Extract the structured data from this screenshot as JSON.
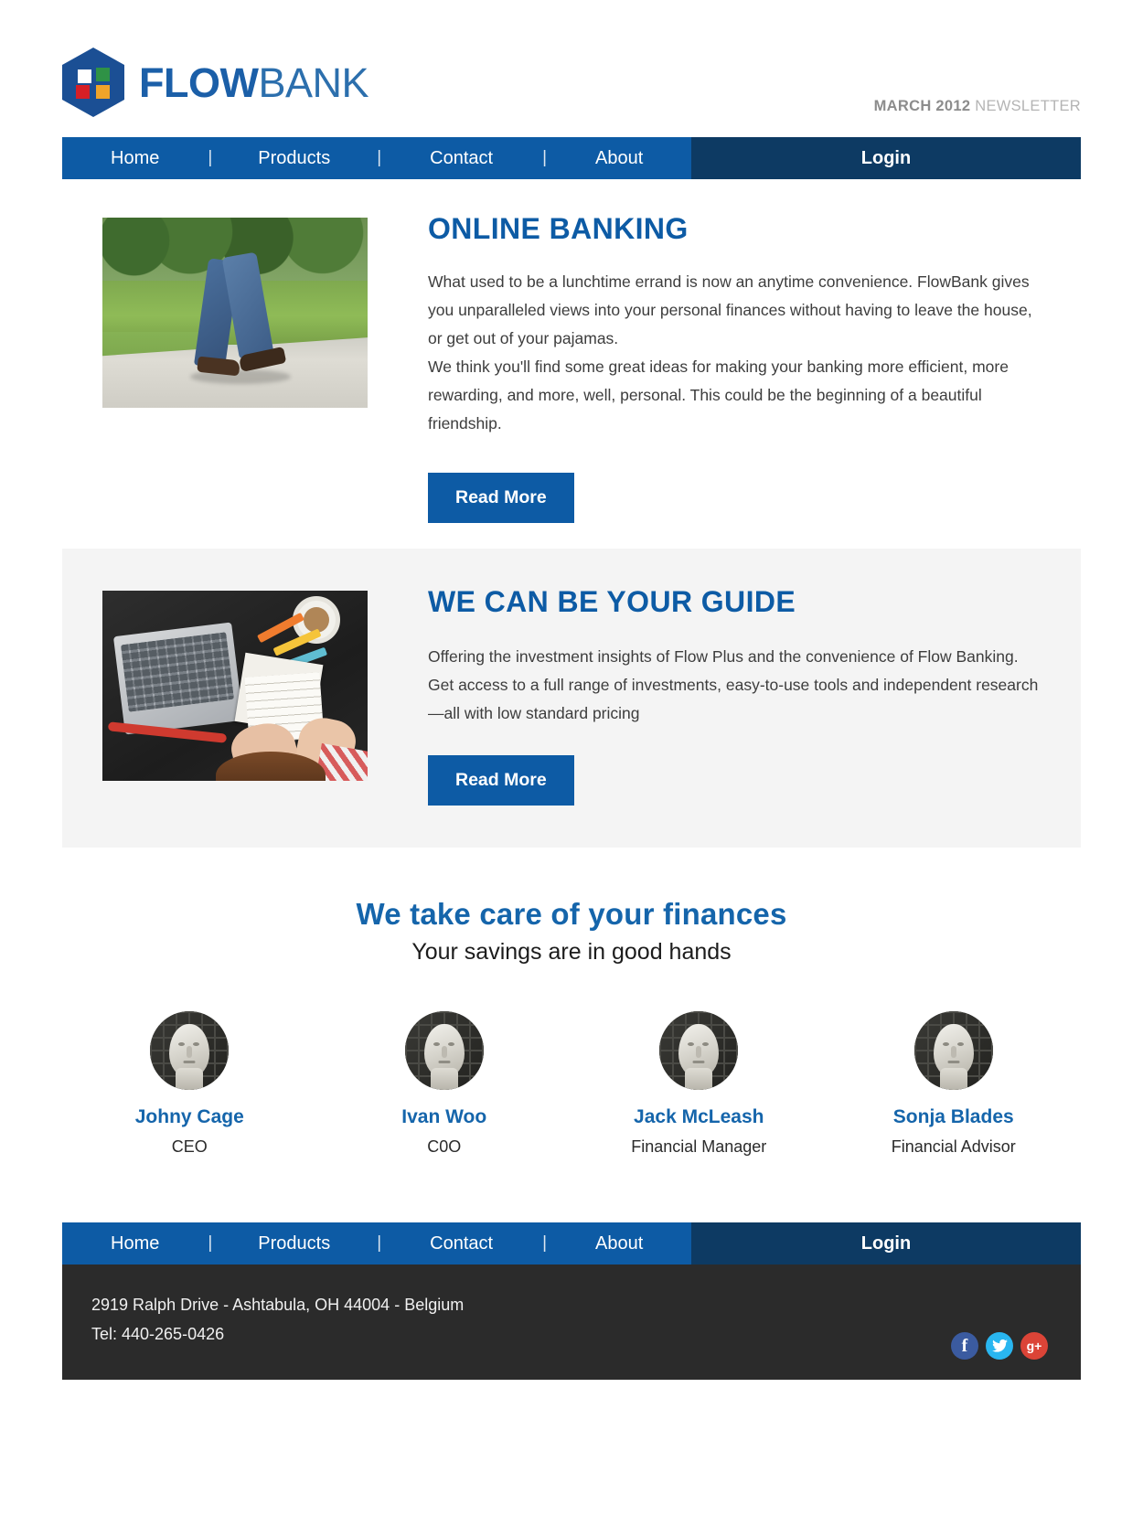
{
  "brand": {
    "name_bold": "FLOW",
    "name_light": "BANK",
    "logo_colors": {
      "hex": "#1b4f94",
      "square_top_left": "#ffffff",
      "square_top_right": "#2f9246",
      "square_bottom_left": "#d61f26",
      "square_bottom_right": "#f0a42a"
    }
  },
  "header": {
    "newsletter_date": "MARCH 2012",
    "newsletter_word": "NEWSLETTER"
  },
  "nav": {
    "items": [
      {
        "label": "Home"
      },
      {
        "label": "Products"
      },
      {
        "label": "Contact"
      },
      {
        "label": "About"
      }
    ],
    "separator": "|",
    "login_label": "Login",
    "bar_color": "#0d5ba5",
    "login_color": "#0d3a63"
  },
  "sections": [
    {
      "title": "ONLINE BANKING",
      "paragraphs": [
        "What used to be a lunchtime errand is now an anytime convenience. FlowBank gives you unparalleled views into your personal finances without having to leave the house, or get out of your pajamas.",
        "We think you'll find some great ideas for making your banking more efficient, more rewarding, and more, well, personal. This could be the beginning of a beautiful friendship."
      ],
      "button_label": "Read More",
      "image_alt": "person-walking-on-path"
    },
    {
      "title": "WE CAN BE YOUR GUIDE",
      "paragraphs": [
        "Offering the investment insights of Flow Plus and the convenience of Flow Banking. Get access to a full range of investments, easy-to-use tools and independent research—all with low standard pricing"
      ],
      "button_label": "Read More",
      "image_alt": "overhead-desk-with-laptop"
    }
  ],
  "team": {
    "title": "We take care of your finances",
    "subtitle": "Your savings are in good hands",
    "members": [
      {
        "name": "Johny Cage",
        "role": "CEO"
      },
      {
        "name": "Ivan Woo",
        "role": "C0O"
      },
      {
        "name": "Jack McLeash",
        "role": "Financial Manager"
      },
      {
        "name": "Sonja Blades",
        "role": "Financial Advisor"
      }
    ]
  },
  "footer": {
    "address": "2919 Ralph Drive - Ashtabula, OH 44004 - Belgium",
    "phone": "Tel: 440-265-0426",
    "socials": [
      {
        "name": "facebook-icon",
        "glyph": "f",
        "color": "#3b5ba0"
      },
      {
        "name": "twitter-icon",
        "glyph": "🐦",
        "color": "#29b6f0"
      },
      {
        "name": "googleplus-icon",
        "glyph": "g+",
        "color": "#db4437"
      }
    ]
  },
  "colors": {
    "primary_blue": "#0d5ba5",
    "dark_blue": "#0d3a63",
    "heading_blue": "#1565ab",
    "alt_section_bg": "#f4f4f4",
    "footer_bg": "#2b2b2b"
  }
}
